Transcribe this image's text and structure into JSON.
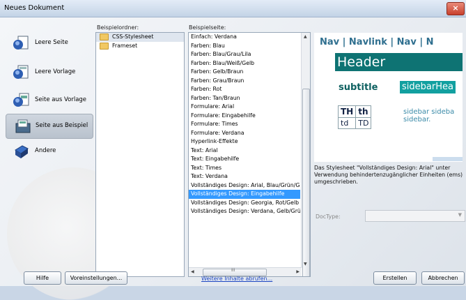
{
  "window": {
    "title": "Neues Dokument",
    "close": "×"
  },
  "categories": [
    {
      "label": "Leere Seite",
      "icon": "blank-page-icon",
      "selected": false
    },
    {
      "label": "Leere Vorlage",
      "icon": "blank-template-icon",
      "selected": false
    },
    {
      "label": "Seite aus Vorlage",
      "icon": "page-from-template-icon",
      "selected": false
    },
    {
      "label": "Seite aus Beispiel",
      "icon": "page-from-sample-icon",
      "selected": true
    },
    {
      "label": "Andere",
      "icon": "other-icon",
      "selected": false
    }
  ],
  "folders": {
    "header": "Beispielordner:",
    "items": [
      {
        "label": "CSS-Stylesheet",
        "selected": true
      },
      {
        "label": "Frameset",
        "selected": false
      }
    ]
  },
  "pages": {
    "header": "Beispielseite:",
    "items": [
      {
        "label": "Einfach: Verdana"
      },
      {
        "label": "Farben: Blau"
      },
      {
        "label": "Farben: Blau/Grau/Lila"
      },
      {
        "label": "Farben: Blau/Weiß/Gelb"
      },
      {
        "label": "Farben: Gelb/Braun"
      },
      {
        "label": "Farben: Grau/Braun"
      },
      {
        "label": "Farben: Rot"
      },
      {
        "label": "Farben: Tan/Braun"
      },
      {
        "label": "Formulare: Arial"
      },
      {
        "label": "Formulare: Eingabehilfe"
      },
      {
        "label": "Formulare: Times"
      },
      {
        "label": "Formulare: Verdana"
      },
      {
        "label": "Hyperlink-Effekte"
      },
      {
        "label": "Text: Arial"
      },
      {
        "label": "Text: Eingabehilfe"
      },
      {
        "label": "Text: Times"
      },
      {
        "label": "Text: Verdana"
      },
      {
        "label": "Vollständiges Design: Arial, Blau/Grün/Gr"
      },
      {
        "label": "Vollständiges Design: Eingabehilfe",
        "selected": true
      },
      {
        "label": "Vollständiges Design: Georgia, Rot/Gelb"
      },
      {
        "label": "Vollständiges Design: Verdana, Gelb/Grün"
      }
    ],
    "hscroll_thumb": "III"
  },
  "preview": {
    "nav": "Nav | Navlink | Nav | N",
    "header": "Header",
    "subtitle": "subtitle",
    "sidebar_head": "sidebarHea",
    "table": {
      "r1c1": "TH",
      "r1c2": "th",
      "r2c1": "td",
      "r2c2": "TD"
    },
    "sidebar_text": "sidebar sideba sidebar."
  },
  "description": "Das Stylesheet \"Vollständiges Design: Arial\" unter Verwendung behindertenzugänglicher Einheiten (ems) umgeschrieben.",
  "doctype": {
    "label": "DocType:",
    "value": ""
  },
  "footer": {
    "help": "Hilfe",
    "preferences": "Voreinstellungen...",
    "more_link": "Weitere Inhalte abrufen...",
    "create": "Erstellen",
    "cancel": "Abbrechen"
  },
  "colors": {
    "selection": "#3399ff",
    "preview_teal": "#0e7373",
    "link": "#1a44c2"
  }
}
